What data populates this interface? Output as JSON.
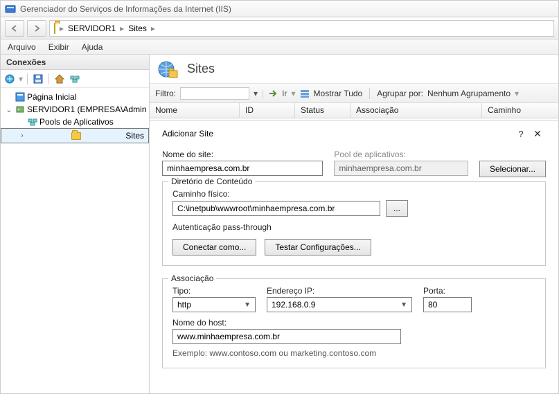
{
  "title": "Gerenciador do Serviços de Informações da Internet (IIS)",
  "breadcrumb": {
    "server": "SERVIDOR1",
    "node": "Sites"
  },
  "menus": {
    "file": "Arquivo",
    "view": "Exibir",
    "help": "Ajuda"
  },
  "sidebar": {
    "header": "Conexões",
    "start_page": "Página Inicial",
    "server": "SERVIDOR1 (EMPRESA\\Admin",
    "app_pools": "Pools de Aplicativos",
    "sites": "Sites"
  },
  "main": {
    "title": "Sites",
    "filter_label": "Filtro:",
    "go": "Ir",
    "show_all": "Mostrar Tudo",
    "group_by": "Agrupar por:",
    "group_value": "Nenhum Agrupamento",
    "cols": {
      "name": "Nome",
      "id": "ID",
      "status": "Status",
      "binding": "Associação",
      "path": "Caminho"
    }
  },
  "dialog": {
    "title": "Adicionar Site",
    "site_name_label": "Nome do site:",
    "site_name": "minhaempresa.com.br",
    "app_pool_label": "Pool de aplicativos:",
    "app_pool": "minhaempresa.com.br",
    "select_btn": "Selecionar...",
    "content_group": "Diretório de Conteúdo",
    "phys_path_label": "Caminho físico:",
    "phys_path": "C:\\inetpub\\wwwroot\\minhaempresa.com.br",
    "browse_btn": "...",
    "passthrough": "Autenticação pass-through",
    "connect_as": "Conectar como...",
    "test_settings": "Testar Configurações...",
    "binding_group": "Associação",
    "type_label": "Tipo:",
    "type_value": "http",
    "ip_label": "Endereço IP:",
    "ip_value": "192.168.0.9",
    "port_label": "Porta:",
    "port_value": "80",
    "host_label": "Nome do host:",
    "host_value": "www.minhaempresa.com.br",
    "example": "Exemplo: www.contoso.com ou marketing.contoso.com"
  }
}
